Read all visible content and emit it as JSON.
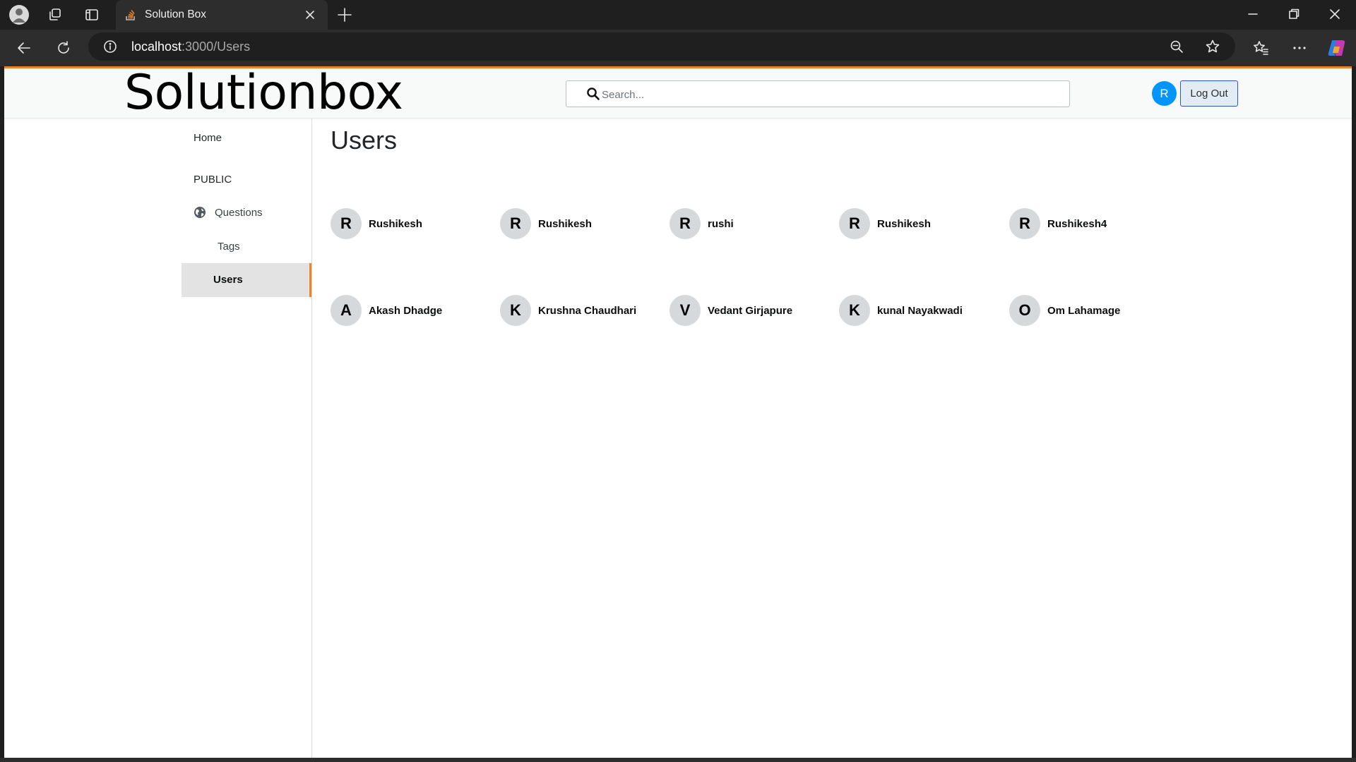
{
  "browser": {
    "tab_title": "Solution Box",
    "url_host": "localhost",
    "url_path": ":3000/Users"
  },
  "header": {
    "logo_text": "Solutionbox",
    "search_placeholder": "Search...",
    "avatar_initial": "R",
    "logout_label": "Log Out"
  },
  "sidebar": {
    "home": "Home",
    "public": "PUBLIC",
    "questions": "Questions",
    "tags": "Tags",
    "users": "Users"
  },
  "main": {
    "title": "Users",
    "users": [
      {
        "initial": "R",
        "name": "Rushikesh"
      },
      {
        "initial": "R",
        "name": "Rushikesh"
      },
      {
        "initial": "R",
        "name": "rushi"
      },
      {
        "initial": "R",
        "name": "Rushikesh"
      },
      {
        "initial": "R",
        "name": "Rushikesh4"
      },
      {
        "initial": "A",
        "name": "Akash Dhadge"
      },
      {
        "initial": "K",
        "name": "Krushna Chaudhari"
      },
      {
        "initial": "V",
        "name": "Vedant Girjapure"
      },
      {
        "initial": "K",
        "name": "kunal Nayakwadi"
      },
      {
        "initial": "O",
        "name": "Om Lahamage"
      }
    ]
  },
  "colors": {
    "accent": "#f48024",
    "avatar_blue": "#0095ff",
    "logout_border": "#2b58c4"
  }
}
